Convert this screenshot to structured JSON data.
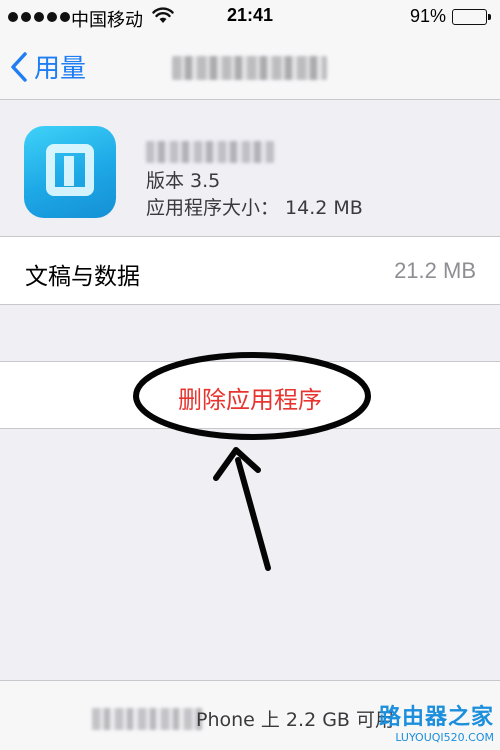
{
  "status_bar": {
    "carrier": "中国移动",
    "time": "21:41",
    "battery_percent": "91%",
    "battery_level": 0.91,
    "icons": [
      "signal-dots-icon",
      "wifi-icon",
      "battery-icon"
    ]
  },
  "nav": {
    "back_label": "用量",
    "back_icon": "chevron-left-icon",
    "accent_color": "#1f7ef2"
  },
  "app": {
    "icon": "app-icon",
    "version": "版本 3.5",
    "size": "应用程序大小： 14.2 MB"
  },
  "documents": {
    "label": "文稿与数据",
    "value": "21.2 MB"
  },
  "delete": {
    "label": "删除应用程序",
    "color": "#e8342f"
  },
  "footer": {
    "storage_text": "Phone 上 2.2 GB 可用"
  },
  "watermark": {
    "main": "路由器之家",
    "sub": "LUYOUQI520.COM"
  }
}
